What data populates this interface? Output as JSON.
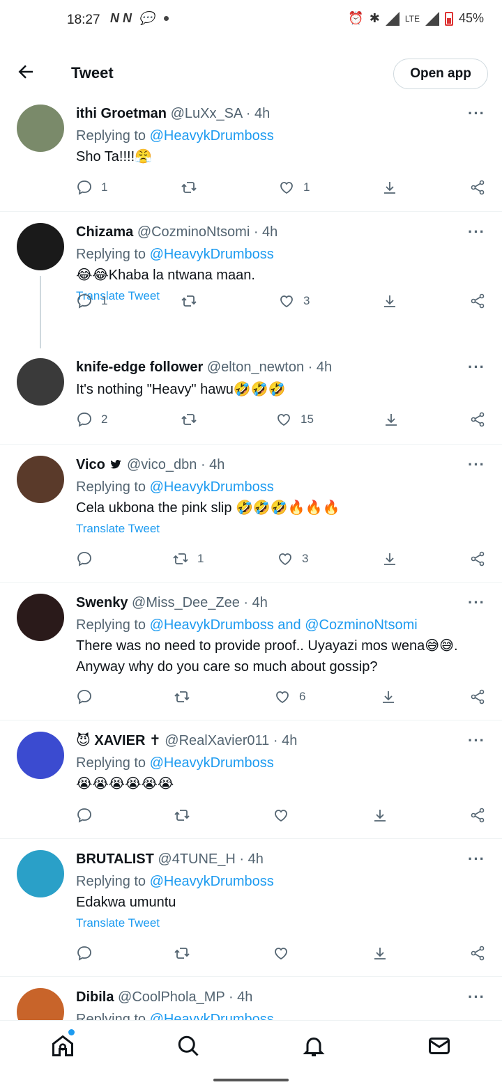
{
  "status_bar": {
    "time": "18:27",
    "left_icons": "N N",
    "network": "LTE",
    "battery": "45%"
  },
  "header": {
    "title": "Tweet",
    "open_app": "Open app"
  },
  "tweets": [
    {
      "name": "ithi Groetman",
      "handle": "@LuXx_SA",
      "time": "· 4h",
      "replying_label": "Replying to",
      "replying_to": "@HeavykDrumboss",
      "text": "Sho Ta!!!!😤",
      "translate": "",
      "replies": "1",
      "retweets": "",
      "likes": "1",
      "avatar_color": "#7a8a6a"
    },
    {
      "name": "Chizama",
      "handle": "@CozminoNtsomi",
      "time": "· 4h",
      "replying_label": "Replying to",
      "replying_to": "@HeavykDrumboss",
      "text": "😂😂Khaba la ntwana maan.",
      "translate": "Translate Tweet",
      "replies": "1",
      "retweets": "",
      "likes": "3",
      "avatar_color": "#1a1a1a"
    },
    {
      "name": "knife-edge follower",
      "handle": "@elton_newton",
      "time": "· 4h",
      "replying_label": "",
      "replying_to": "",
      "text": "It's nothing \"Heavy\" hawu🤣🤣🤣",
      "translate": "",
      "replies": "2",
      "retweets": "",
      "likes": "15",
      "avatar_color": "#3a3a3a"
    },
    {
      "name": "Vico",
      "handle": "@vico_dbn",
      "time": "· 4h",
      "replying_label": "Replying to",
      "replying_to": "@HeavykDrumboss",
      "text": "Cela ukbona the pink slip 🤣🤣🤣🔥🔥🔥",
      "translate": "Translate Tweet",
      "replies": "",
      "retweets": "1",
      "likes": "3",
      "avatar_color": "#5a3a2a"
    },
    {
      "name": "Swenky",
      "handle": "@Miss_Dee_Zee",
      "time": "· 4h",
      "replying_label": "Replying to",
      "replying_to": "@HeavykDrumboss and @CozminoNtsomi",
      "text": "There was no need to provide proof.. Uyayazi mos wena😅😅. Anyway why do you care so much about gossip?",
      "translate": "",
      "replies": "",
      "retweets": "",
      "likes": "6",
      "avatar_color": "#2a1a1a"
    },
    {
      "name": "XAVIER ✝",
      "handle": "@RealXavier011",
      "time": "· 4h",
      "replying_label": "Replying to",
      "replying_to": "@HeavykDrumboss",
      "text": "😭😭😭😭😭😭",
      "translate": "",
      "replies": "",
      "retweets": "",
      "likes": "",
      "avatar_color": "#3b4bd0"
    },
    {
      "name": "BRUTALIST",
      "handle": "@4TUNE_H",
      "time": "· 4h",
      "replying_label": "Replying to",
      "replying_to": "@HeavykDrumboss",
      "text": "Edakwa umuntu",
      "translate": "Translate Tweet",
      "replies": "",
      "retweets": "",
      "likes": "",
      "avatar_color": "#2aa0c8"
    },
    {
      "name": "Dibila",
      "handle": "@CoolPhola_MP",
      "time": "· 4h",
      "replying_label": "Replying to",
      "replying_to": "@HeavykDrumboss",
      "text": "",
      "translate": "",
      "replies": "",
      "retweets": "",
      "likes": "",
      "avatar_color": "#c8642a"
    }
  ],
  "icons": {
    "more": "···",
    "xavier_prefix": "😈",
    "vico_badge": "twitter-bird-icon"
  },
  "colors": {
    "accent": "#1d9bf0",
    "text": "#0f1419",
    "secondary": "#536471"
  }
}
